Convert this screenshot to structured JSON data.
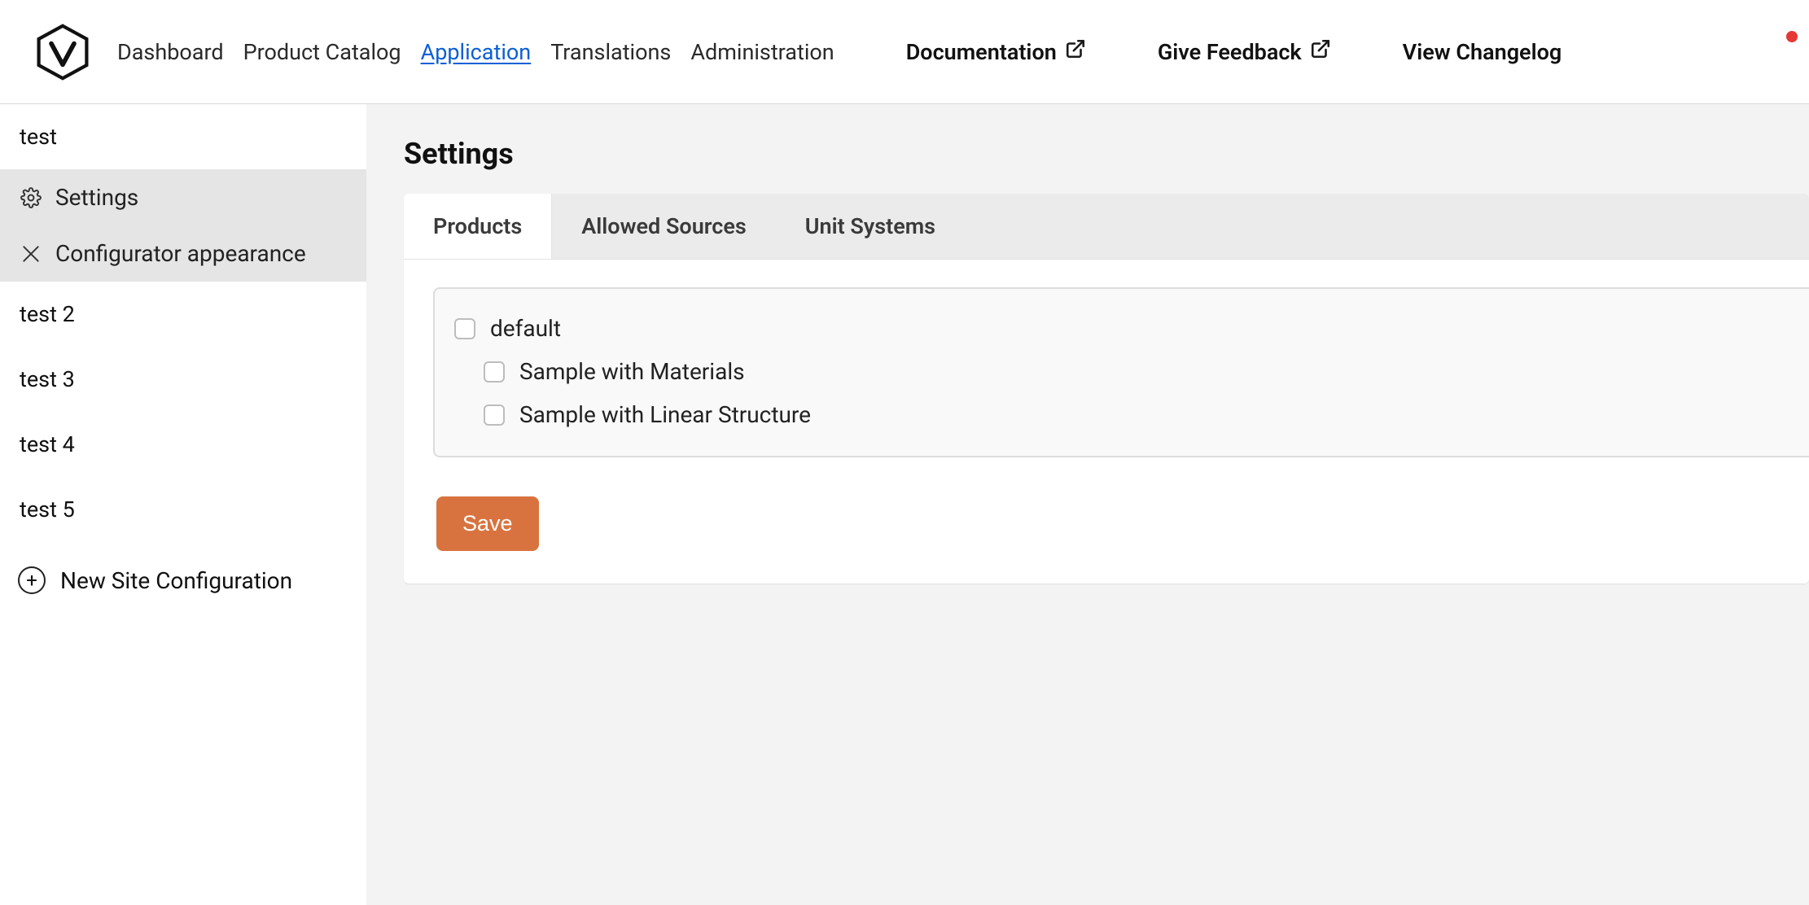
{
  "colors": {
    "accent": "#d8733f",
    "link": "#0b5fd6",
    "notification": "#e53935"
  },
  "header": {
    "nav_primary": [
      {
        "label": "Dashboard"
      },
      {
        "label": "Product Catalog"
      },
      {
        "label": "Application",
        "active": true
      },
      {
        "label": "Translations"
      },
      {
        "label": "Administration"
      }
    ],
    "nav_external": [
      {
        "label": "Documentation"
      },
      {
        "label": "Give Feedback"
      }
    ],
    "nav_right": {
      "label": "View Changelog"
    },
    "notification": true
  },
  "sidebar": {
    "sites": [
      {
        "label": "test",
        "expanded": true,
        "items": [
          {
            "icon": "gear-icon",
            "label": "Settings"
          },
          {
            "icon": "appearance-icon",
            "label": "Configurator appearance"
          }
        ]
      },
      {
        "label": "test 2"
      },
      {
        "label": "test 3"
      },
      {
        "label": "test 4"
      },
      {
        "label": "test 5"
      }
    ],
    "new_site_label": "New Site Configuration"
  },
  "main": {
    "page_title": "Settings",
    "tabs": [
      {
        "label": "Products",
        "active": true
      },
      {
        "label": "Allowed Sources"
      },
      {
        "label": "Unit Systems"
      }
    ],
    "products": [
      {
        "label": "default",
        "checked": false,
        "level": 0
      },
      {
        "label": "Sample with Materials",
        "checked": false,
        "level": 1
      },
      {
        "label": "Sample with Linear Structure",
        "checked": false,
        "level": 1
      }
    ],
    "save_label": "Save"
  }
}
